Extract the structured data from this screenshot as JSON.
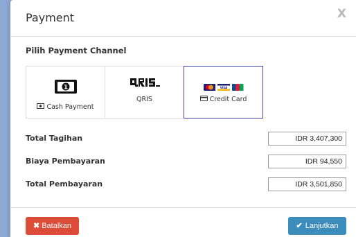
{
  "modal": {
    "title": "Payment",
    "close_label": "X"
  },
  "channel_section": {
    "label": "Pilih Payment Channel",
    "channels": [
      {
        "label": "Cash Payment",
        "icon": "banknote-icon",
        "selected": false
      },
      {
        "label": "QRIS",
        "icon": "qris-logo-icon",
        "selected": false
      },
      {
        "label": "Credit Card",
        "icon": "credit-card-icon",
        "selected": true
      }
    ]
  },
  "summary": {
    "total_tagihan_label": "Total Tagihan",
    "total_tagihan_value": "IDR 3,407,300",
    "biaya_label": "Biaya Pembayaran",
    "biaya_value": "IDR 94,550",
    "total_pembayaran_label": "Total Pembayaran",
    "total_pembayaran_value": "IDR 3,501,850"
  },
  "footer": {
    "cancel_label": "Batalkan",
    "next_label": "Lanjutkan"
  },
  "colors": {
    "cancel": "#dd4b39",
    "next": "#3c8dbc",
    "selected_border": "#3f3fa8",
    "backdrop": "#8fa9d6"
  }
}
